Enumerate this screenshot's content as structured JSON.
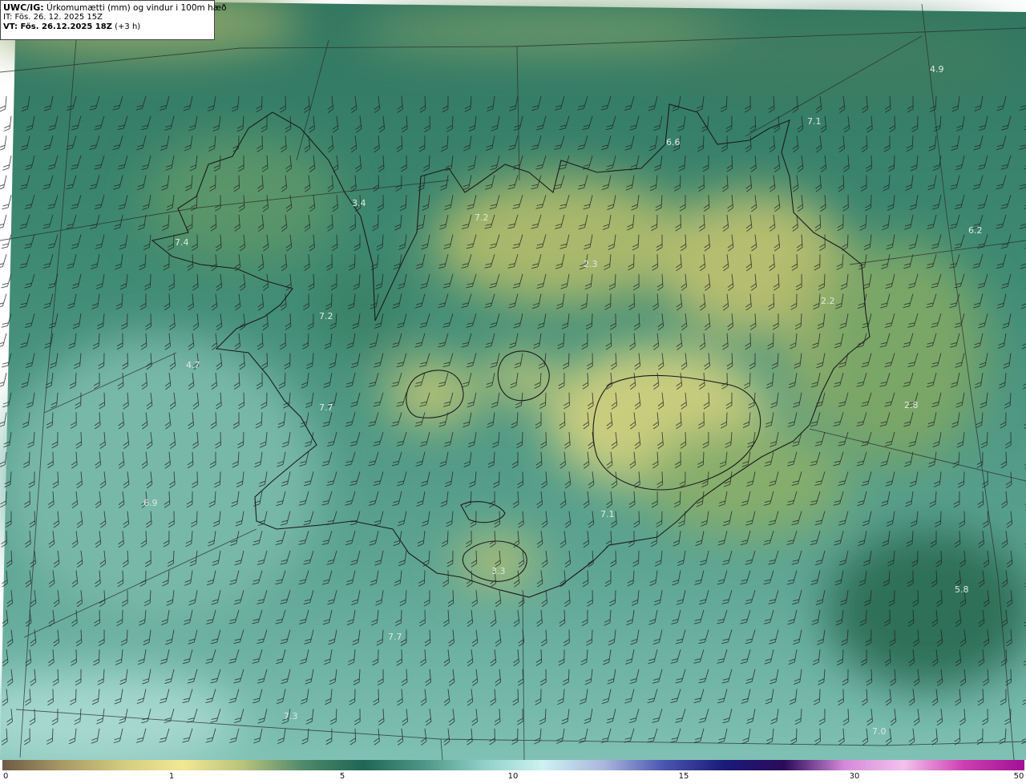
{
  "header": {
    "model": "UWC/IG:",
    "field": "Úrkomumætti (mm) og vindur i 100m hæð",
    "issue_time": "IT: Fös. 26. 12. 2025 15Z",
    "valid_prefix": "VT: Fös. 26.12.2025 18Z",
    "valid_offset": "(+3 h)"
  },
  "map": {
    "region": "Iceland",
    "value_labels": [
      "4.9",
      "7.1",
      "6.6",
      "3.4",
      "7.2",
      "7.4",
      "6.2",
      "2.3",
      "2.2",
      "7.2",
      "4.7",
      "2.8",
      "7.7",
      "6.9",
      "7.1",
      "3.3",
      "5.8",
      "7.7",
      "7.3",
      "7.0"
    ]
  },
  "colorbar": {
    "ticks": [
      "0",
      "1",
      "5",
      "10",
      "15",
      "30",
      "50"
    ],
    "colors": [
      "#6e5a46",
      "#a99a65",
      "#d2cc80",
      "#f2e894",
      "#b9c37c",
      "#4f8a6a",
      "#1f6655",
      "#4d9687",
      "#8fd0c8",
      "#cdf2f2",
      "#aab7de",
      "#4b56b0",
      "#1a1a7a",
      "#2b0a5a",
      "#d48ad8",
      "#f3c1ee",
      "#cc3fb0",
      "#a20f96"
    ]
  }
}
